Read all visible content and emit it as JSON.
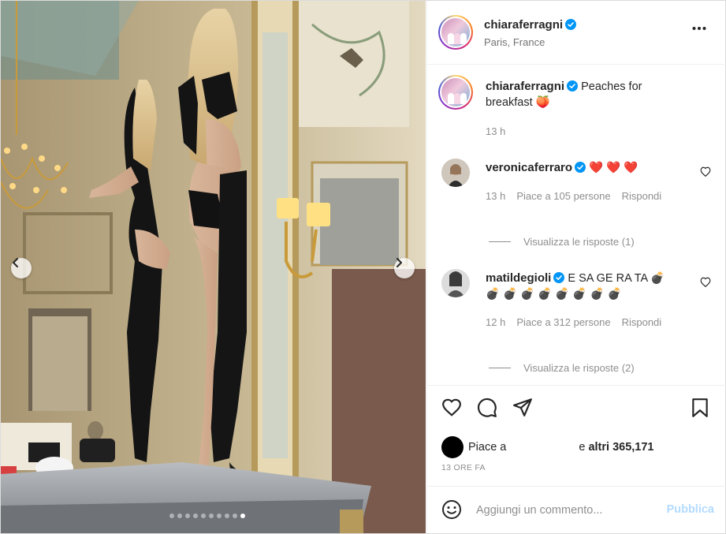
{
  "post": {
    "author": "chiaraferragni",
    "location": "Paris, France",
    "verified": true,
    "image": {
      "alt_description": "",
      "carousel_count": 10,
      "active_index": 9
    }
  },
  "caption": {
    "username": "chiaraferragni",
    "text": "Peaches for breakfast 🍑",
    "time": "13 h"
  },
  "comments": [
    {
      "username": "veronicaferraro",
      "text": "❤️ ❤️ ❤️",
      "time": "13 h",
      "likes": "Piace a 105 persone",
      "reply": "Rispondi",
      "view_replies": "Visualizza le risposte (1)"
    },
    {
      "username": "matildegioli",
      "text": "E SA GE RA TA 💣",
      "text_line2": "💣 💣 💣 💣 💣 💣 💣 💣",
      "time": "12 h",
      "likes": "Piace a 312 persone",
      "reply": "Rispondi",
      "view_replies": "Visualizza le risposte (2)"
    }
  ],
  "likes": {
    "prefix": "Piace a",
    "suffix_prefix": "e",
    "suffix_bold": "altri 365,171"
  },
  "time_ago": "13 ORE FA",
  "composer": {
    "placeholder": "Aggiungi un commento...",
    "post_label": "Pubblica"
  },
  "colors": {
    "verified_blue": "#0095f6",
    "post_button_disabled": "#b3dbff",
    "secondary_text": "#8e8e8e"
  },
  "icons": [
    "more-icon",
    "verified-icon",
    "heart-icon",
    "comment-icon",
    "share-icon",
    "bookmark-icon",
    "emoji-icon",
    "chevron-left-icon",
    "chevron-right-icon"
  ]
}
